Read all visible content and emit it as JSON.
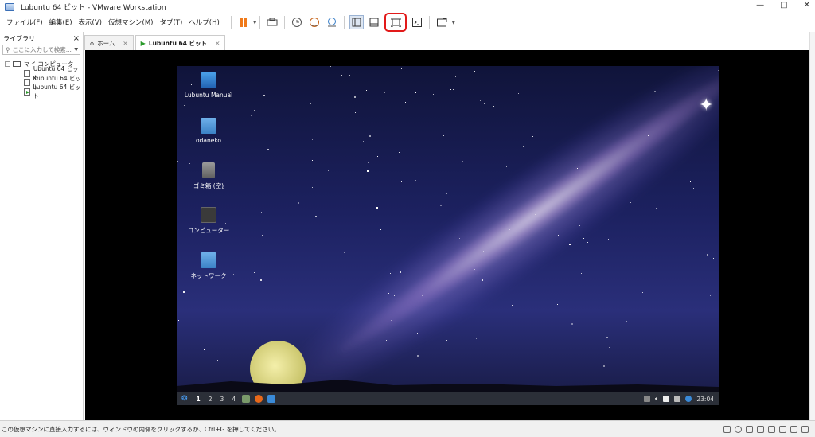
{
  "window": {
    "title": "Lubuntu 64 ビット - VMware Workstation",
    "controls": [
      "—",
      "□",
      "✕"
    ]
  },
  "menu": {
    "items": [
      "ファイル(F)",
      "編集(E)",
      "表示(V)",
      "仮想マシン(M)",
      "タブ(T)",
      "ヘルプ(H)"
    ]
  },
  "toolbar": {
    "highlighted": "full-screen-button",
    "highlight_color": "#e21a1a",
    "pause_color": "#f07a1a"
  },
  "library": {
    "title": "ライブラリ",
    "close": "×",
    "search_placeholder": "ここに入力して検索...",
    "root": "マイ コンピュータ",
    "vms": [
      "Ubuntu 64 ビット",
      "Kubuntu 64 ビット",
      "Lubuntu 64 ビット"
    ],
    "running_vm_index": 2
  },
  "tabs": [
    {
      "label": "ホーム",
      "active": false
    },
    {
      "label": "Lubuntu 64 ビット",
      "active": true
    }
  ],
  "desktop": {
    "icons": [
      {
        "label": "Lubuntu Manual",
        "icon": "manual-icon"
      },
      {
        "label": "odaneko",
        "icon": "home-folder-icon"
      },
      {
        "label": "ゴミ箱 (空)",
        "icon": "trash-icon"
      },
      {
        "label": "コンピューター",
        "icon": "computer-icon"
      },
      {
        "label": "ネットワーク",
        "icon": "network-icon"
      }
    ],
    "panel": {
      "desktops": [
        "1",
        "2",
        "3",
        "4"
      ],
      "clock": "23:04"
    }
  },
  "status": {
    "message": "この仮想マシンに直接入力するには、ウィンドウの内側をクリックするか、Ctrl+G を押してください。"
  }
}
